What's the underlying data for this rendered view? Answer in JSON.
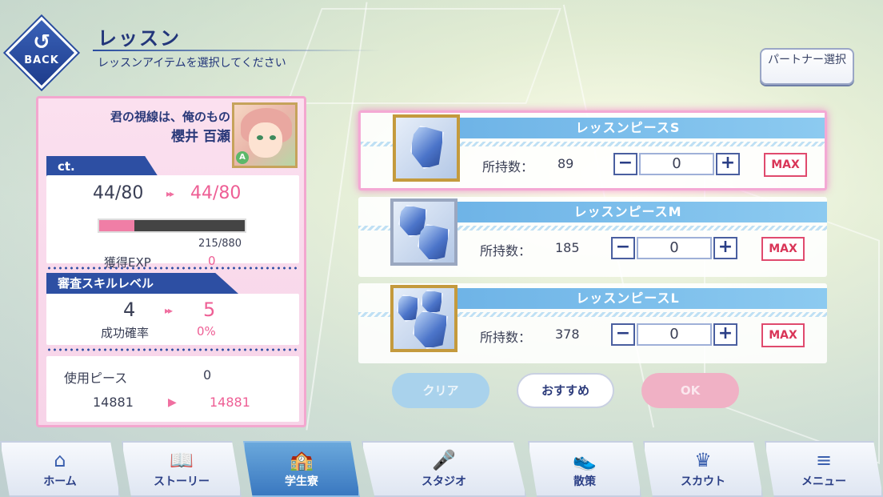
{
  "header": {
    "back_label": "BACK",
    "back_arrow": "↺",
    "title": "レッスン",
    "subtitle": "レッスンアイテムを選択してください",
    "partner_button": "パートナー選択"
  },
  "character": {
    "card_title": "君の視線は、俺のもの",
    "name": "櫻井 百瀬",
    "rank": "A"
  },
  "ct": {
    "tab_label": "ct.",
    "from": "44/80",
    "to": "44/80",
    "arrow": "▸▸",
    "exp_progress": "215/880",
    "exp_fraction": 0.244,
    "gained_exp_label": "獲得EXP",
    "gained_exp_value": "0"
  },
  "skill": {
    "tab_label": "審査スキルレベル",
    "from": "4",
    "to": "5",
    "arrow": "▸▸",
    "success_label": "成功確率",
    "success_value": "0%"
  },
  "usage": {
    "label": "使用ピース",
    "value": "0",
    "coins_from": "14881",
    "coins_to": "14881",
    "arrow": "▶"
  },
  "items": [
    {
      "name": "レッスンピースS",
      "own_label": "所持数：",
      "own": "89",
      "qty": "0",
      "minus": "−",
      "plus": "+",
      "max": "MAX",
      "selected": true
    },
    {
      "name": "レッスンピースM",
      "own_label": "所持数：",
      "own": "185",
      "qty": "0",
      "minus": "−",
      "plus": "+",
      "max": "MAX",
      "selected": false
    },
    {
      "name": "レッスンピースL",
      "own_label": "所持数：",
      "own": "378",
      "qty": "0",
      "minus": "−",
      "plus": "+",
      "max": "MAX",
      "selected": false
    }
  ],
  "actions": {
    "clear": "クリア",
    "recommend": "おすすめ",
    "ok": "OK"
  },
  "nav": [
    {
      "label": "ホーム",
      "icon": "⌂"
    },
    {
      "label": "ストーリー",
      "icon": "📖"
    },
    {
      "label": "学生寮",
      "icon": "🏫"
    },
    {
      "label": "スタジオ",
      "icon": "🎤"
    },
    {
      "label": "散策",
      "icon": "👟"
    },
    {
      "label": "スカウト",
      "icon": "♛"
    },
    {
      "label": "メニュー",
      "icon": "≡"
    }
  ],
  "colors": {
    "accent_blue": "#2d4fa3",
    "accent_pink": "#ee5f95",
    "item_title": "#6cb2e6"
  }
}
